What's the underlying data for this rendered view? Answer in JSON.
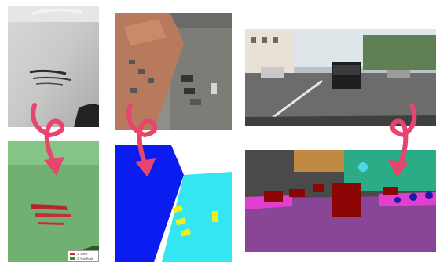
{
  "panels": [
    {
      "id": "car-scratch-photo"
    },
    {
      "id": "car-scratch-segmentation"
    },
    {
      "id": "aerial-building-photo"
    },
    {
      "id": "aerial-building-segmentation"
    },
    {
      "id": "street-scene-photo"
    },
    {
      "id": "street-scene-segmentation"
    }
  ],
  "legend": {
    "items": [
      {
        "label": "1: Dent",
        "color": "#c3303a"
      },
      {
        "label": "2: Not Rust",
        "color": "#2f8f2f"
      }
    ]
  },
  "colors": {
    "arrow": "#e8456e",
    "building_blue": "#0a1cf0",
    "road_cyan": "#33e6f2",
    "car_yellow": "#f4ee18",
    "road_purple": "#8a4696",
    "vehicle_darkred": "#8c0505"
  }
}
